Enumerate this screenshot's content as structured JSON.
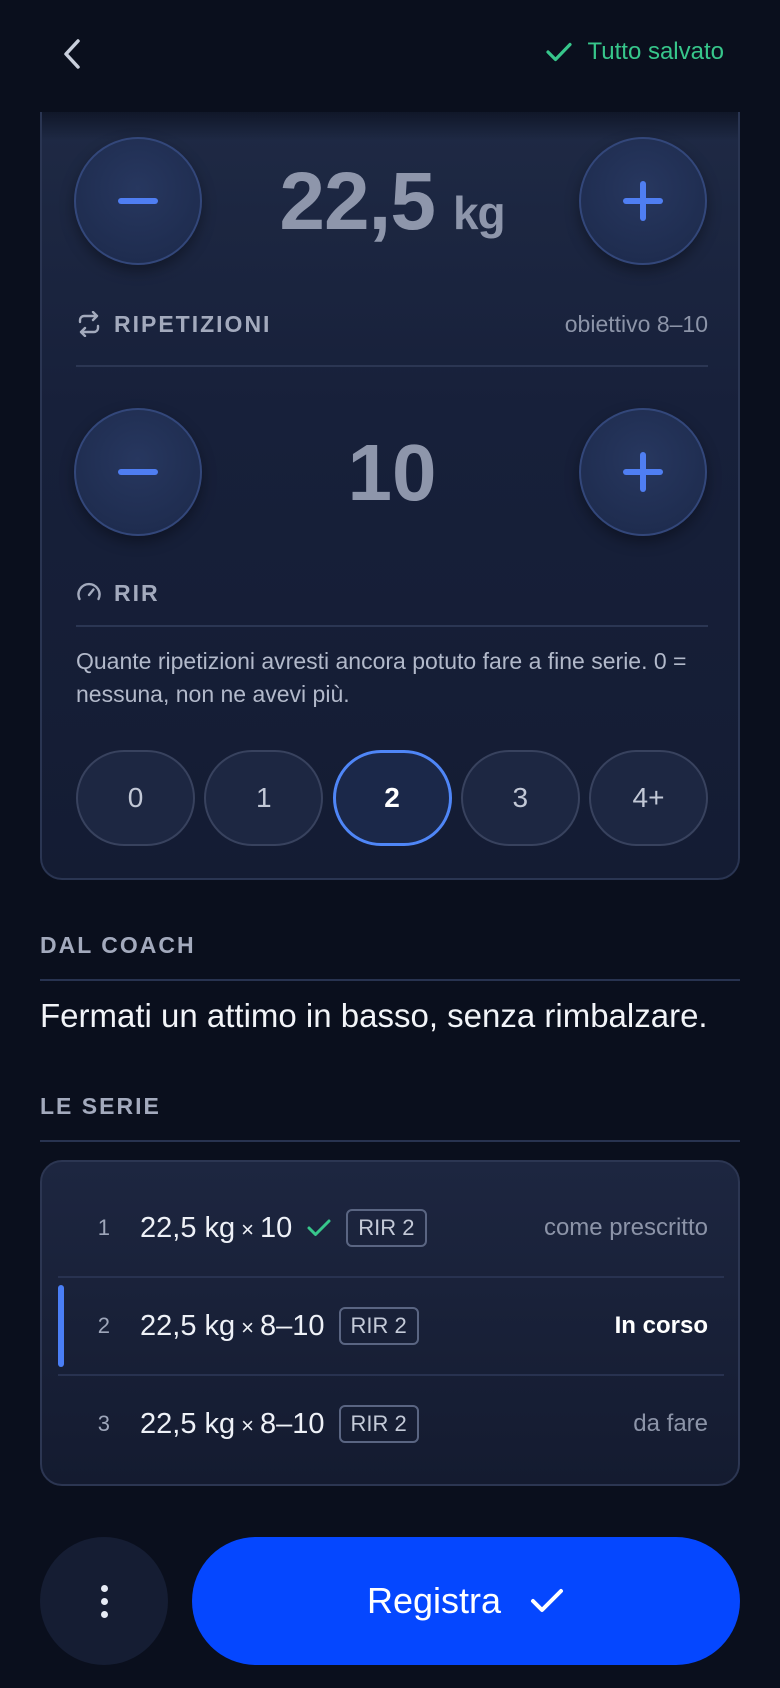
{
  "header": {
    "saved_label": "Tutto salvato"
  },
  "weight": {
    "value": "22,5",
    "unit": "kg"
  },
  "reps": {
    "section_label": "RIPETIZIONI",
    "goal_label": "obiettivo 8–10",
    "value": "10"
  },
  "rir": {
    "section_label": "RIR",
    "description": "Quante ripetizioni avresti ancora potuto fare a fine serie. 0 = nessuna, non ne avevi più.",
    "options": [
      "0",
      "1",
      "2",
      "3",
      "4+"
    ],
    "selected": "2"
  },
  "coach": {
    "title": "DAL COACH",
    "text": "Fermati un attimo in basso, senza rimbalzare."
  },
  "series": {
    "title": "LE SERIE",
    "rows": [
      {
        "num": "1",
        "weight": "22,5 kg",
        "x": "×",
        "reps": "10",
        "rir": "RIR 2",
        "status": "come prescritto",
        "done": true
      },
      {
        "num": "2",
        "weight": "22,5 kg",
        "x": "×",
        "reps": "8–10",
        "rir": "RIR 2",
        "status": "In corso",
        "current": true
      },
      {
        "num": "3",
        "weight": "22,5 kg",
        "x": "×",
        "reps": "8–10",
        "rir": "RIR 2",
        "status": "da fare"
      }
    ]
  },
  "footer": {
    "register_label": "Registra"
  },
  "colors": {
    "accent": "#0547ff",
    "success": "#37c68b",
    "selected_border": "#4f86f7"
  },
  "icons": [
    "chevron-left-icon",
    "check-icon",
    "repeat-icon",
    "gauge-icon",
    "more-vertical-icon"
  ]
}
